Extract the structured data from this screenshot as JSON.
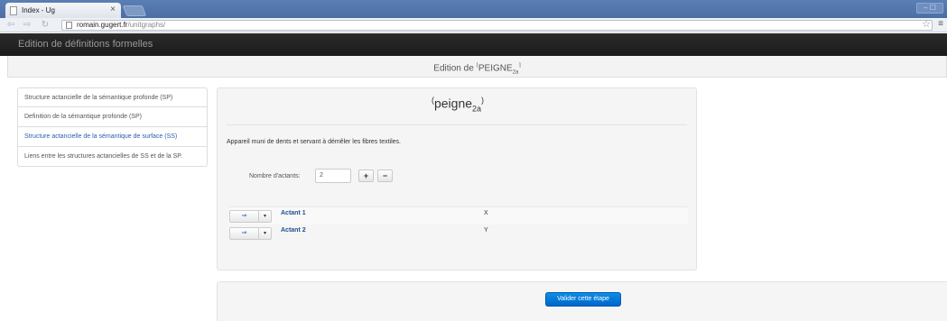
{
  "browser": {
    "tab_title": "Index - Ug",
    "tab_close": "×",
    "url_host": "romain.gugert.fr",
    "url_path": "/unitgraphs/",
    "back": "⇦",
    "forward": "⇨",
    "reload": "↻",
    "star": "☆",
    "menu": "≡",
    "window_controls": "– ☐"
  },
  "navbar": {
    "brand": "Edition de définitions formelles"
  },
  "header": {
    "prefix": "Edition de ",
    "open_corner": "⌈",
    "lemma": "PEIGNE",
    "lemma_sub": "2a",
    "close_corner": "⌉"
  },
  "sidebar": {
    "items": [
      {
        "label": "Structure actancielle de la sémantique profonde (SP)"
      },
      {
        "label": "Definition de la sémantique profonde (SP)"
      },
      {
        "label": "Structure actancielle de la sémantique de surface (SS)"
      },
      {
        "label": "Liens entre les structures actancielles de SS et de la SP."
      }
    ],
    "active_index": 2
  },
  "panel": {
    "lemma_open": "(",
    "lemma": "peigne",
    "lemma_sub": "2a",
    "lemma_close": ")",
    "definition": "Appareil muni de dents et servant à démêler les fibres textiles.",
    "nb_actants_label": "Nombre d'actants:",
    "nb_actants_value": "2",
    "plus_label": "+",
    "minus_label": "−",
    "actants": [
      {
        "arrow": "⇒",
        "caret": "▾",
        "name": "Actant 1",
        "var": "X"
      },
      {
        "arrow": "⇒",
        "caret": "▾",
        "name": "Actant 2",
        "var": "Y"
      }
    ]
  },
  "footer": {
    "validate_label": "Valider cette étape"
  },
  "colors": {
    "navbar": "#1a1a1a",
    "active_link": "#2a5db0",
    "primary": "#0074d9"
  }
}
